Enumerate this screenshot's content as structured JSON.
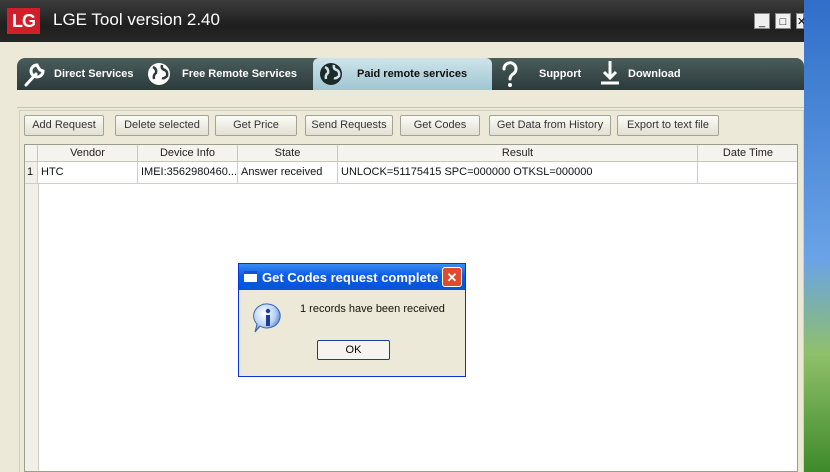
{
  "window": {
    "title": "LGE Tool version 2.40",
    "logo_text": "LG",
    "minimize_glyph": "_",
    "maximize_glyph": "□",
    "close_glyph": "✕"
  },
  "tabs": [
    {
      "label": "Direct Services",
      "icon": "wrench-icon"
    },
    {
      "label": "Free Remote Services",
      "icon": "globe-icon"
    },
    {
      "label": "Paid remote services",
      "icon": "globe-icon",
      "active": true
    },
    {
      "label": "Support",
      "icon": "question-mark-icon"
    },
    {
      "label": "Download",
      "icon": "download-arrow-icon"
    }
  ],
  "toolbar": {
    "add_request": "Add Request",
    "delete_selected": "Delete selected",
    "get_price": "Get Price",
    "send_requests": "Send Requests",
    "get_codes": "Get Codes",
    "get_data_history": "Get Data from History",
    "export_text": "Export to text file"
  },
  "table": {
    "columns": [
      "Vendor",
      "Device Info",
      "State",
      "Result",
      "Date Time"
    ],
    "rows": [
      {
        "index": "1",
        "vendor": "HTC",
        "device_info": "IMEI:3562980460...",
        "state": "Answer received",
        "result": "UNLOCK=51175415 SPC=000000 OTKSL=000000",
        "date_time": ""
      }
    ]
  },
  "dialog": {
    "title": "Get Codes request complete",
    "message": "1 records have been received",
    "ok_label": "OK",
    "close_glyph": "✕",
    "icon": "info-icon"
  },
  "colors": {
    "title_bar": "#262626",
    "tab_bar": "#3a4a4a",
    "active_tab": "#b3d5df",
    "dialog_title": "#0a5ee6",
    "dialog_close": "#e04a2e",
    "logo": "#d01f2a"
  }
}
